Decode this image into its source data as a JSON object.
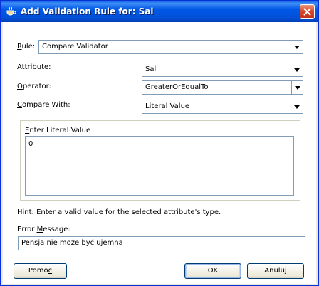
{
  "window": {
    "title": "Add Validation Rule for: Sal"
  },
  "rule": {
    "label": "Rule:",
    "value": "Compare Validator"
  },
  "attribute": {
    "label": "Attribute:",
    "value": "Sal"
  },
  "operator": {
    "label": "Operator:",
    "value": "GreaterOrEqualTo"
  },
  "compare_with": {
    "label": "Compare With:",
    "value": "Literal Value"
  },
  "literal": {
    "label": "Enter Literal Value",
    "value": "0"
  },
  "hint": "Hint: Enter a valid value for the selected attribute's type.",
  "error_message": {
    "label": "Error Message:",
    "value": "Pensja nie może być ujemna"
  },
  "buttons": {
    "help": "Pomoc",
    "ok": "OK",
    "cancel": "Anuluj"
  },
  "colors": {
    "title_bar": "#0058e6",
    "close_button": "#d4442a",
    "field_border": "#7f9db9"
  },
  "icons": {
    "title": "jdeveloper-cup-icon",
    "close": "close-icon",
    "dropdown": "chevron-down-icon"
  }
}
